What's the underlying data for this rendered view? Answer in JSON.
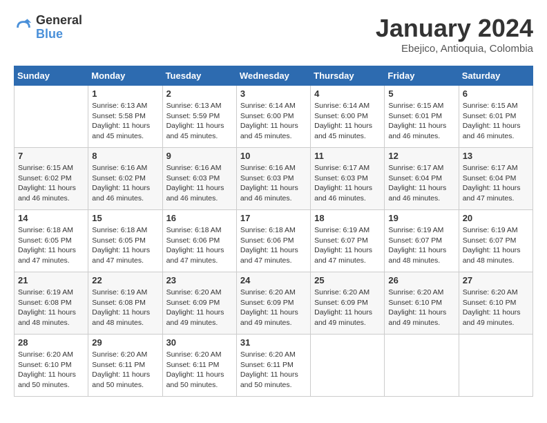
{
  "header": {
    "logo_line1": "General",
    "logo_line2": "Blue",
    "month_title": "January 2024",
    "location": "Ebejico, Antioquia, Colombia"
  },
  "weekdays": [
    "Sunday",
    "Monday",
    "Tuesday",
    "Wednesday",
    "Thursday",
    "Friday",
    "Saturday"
  ],
  "weeks": [
    [
      {
        "day": "",
        "empty": true
      },
      {
        "day": "1",
        "sunrise": "6:13 AM",
        "sunset": "5:58 PM",
        "daylight": "11 hours and 45 minutes."
      },
      {
        "day": "2",
        "sunrise": "6:13 AM",
        "sunset": "5:59 PM",
        "daylight": "11 hours and 45 minutes."
      },
      {
        "day": "3",
        "sunrise": "6:14 AM",
        "sunset": "6:00 PM",
        "daylight": "11 hours and 45 minutes."
      },
      {
        "day": "4",
        "sunrise": "6:14 AM",
        "sunset": "6:00 PM",
        "daylight": "11 hours and 45 minutes."
      },
      {
        "day": "5",
        "sunrise": "6:15 AM",
        "sunset": "6:01 PM",
        "daylight": "11 hours and 46 minutes."
      },
      {
        "day": "6",
        "sunrise": "6:15 AM",
        "sunset": "6:01 PM",
        "daylight": "11 hours and 46 minutes."
      }
    ],
    [
      {
        "day": "7",
        "sunrise": "6:15 AM",
        "sunset": "6:02 PM",
        "daylight": "11 hours and 46 minutes."
      },
      {
        "day": "8",
        "sunrise": "6:16 AM",
        "sunset": "6:02 PM",
        "daylight": "11 hours and 46 minutes."
      },
      {
        "day": "9",
        "sunrise": "6:16 AM",
        "sunset": "6:03 PM",
        "daylight": "11 hours and 46 minutes."
      },
      {
        "day": "10",
        "sunrise": "6:16 AM",
        "sunset": "6:03 PM",
        "daylight": "11 hours and 46 minutes."
      },
      {
        "day": "11",
        "sunrise": "6:17 AM",
        "sunset": "6:03 PM",
        "daylight": "11 hours and 46 minutes."
      },
      {
        "day": "12",
        "sunrise": "6:17 AM",
        "sunset": "6:04 PM",
        "daylight": "11 hours and 46 minutes."
      },
      {
        "day": "13",
        "sunrise": "6:17 AM",
        "sunset": "6:04 PM",
        "daylight": "11 hours and 47 minutes."
      }
    ],
    [
      {
        "day": "14",
        "sunrise": "6:18 AM",
        "sunset": "6:05 PM",
        "daylight": "11 hours and 47 minutes."
      },
      {
        "day": "15",
        "sunrise": "6:18 AM",
        "sunset": "6:05 PM",
        "daylight": "11 hours and 47 minutes."
      },
      {
        "day": "16",
        "sunrise": "6:18 AM",
        "sunset": "6:06 PM",
        "daylight": "11 hours and 47 minutes."
      },
      {
        "day": "17",
        "sunrise": "6:18 AM",
        "sunset": "6:06 PM",
        "daylight": "11 hours and 47 minutes."
      },
      {
        "day": "18",
        "sunrise": "6:19 AM",
        "sunset": "6:07 PM",
        "daylight": "11 hours and 47 minutes."
      },
      {
        "day": "19",
        "sunrise": "6:19 AM",
        "sunset": "6:07 PM",
        "daylight": "11 hours and 48 minutes."
      },
      {
        "day": "20",
        "sunrise": "6:19 AM",
        "sunset": "6:07 PM",
        "daylight": "11 hours and 48 minutes."
      }
    ],
    [
      {
        "day": "21",
        "sunrise": "6:19 AM",
        "sunset": "6:08 PM",
        "daylight": "11 hours and 48 minutes."
      },
      {
        "day": "22",
        "sunrise": "6:19 AM",
        "sunset": "6:08 PM",
        "daylight": "11 hours and 48 minutes."
      },
      {
        "day": "23",
        "sunrise": "6:20 AM",
        "sunset": "6:09 PM",
        "daylight": "11 hours and 49 minutes."
      },
      {
        "day": "24",
        "sunrise": "6:20 AM",
        "sunset": "6:09 PM",
        "daylight": "11 hours and 49 minutes."
      },
      {
        "day": "25",
        "sunrise": "6:20 AM",
        "sunset": "6:09 PM",
        "daylight": "11 hours and 49 minutes."
      },
      {
        "day": "26",
        "sunrise": "6:20 AM",
        "sunset": "6:10 PM",
        "daylight": "11 hours and 49 minutes."
      },
      {
        "day": "27",
        "sunrise": "6:20 AM",
        "sunset": "6:10 PM",
        "daylight": "11 hours and 49 minutes."
      }
    ],
    [
      {
        "day": "28",
        "sunrise": "6:20 AM",
        "sunset": "6:10 PM",
        "daylight": "11 hours and 50 minutes."
      },
      {
        "day": "29",
        "sunrise": "6:20 AM",
        "sunset": "6:11 PM",
        "daylight": "11 hours and 50 minutes."
      },
      {
        "day": "30",
        "sunrise": "6:20 AM",
        "sunset": "6:11 PM",
        "daylight": "11 hours and 50 minutes."
      },
      {
        "day": "31",
        "sunrise": "6:20 AM",
        "sunset": "6:11 PM",
        "daylight": "11 hours and 50 minutes."
      },
      {
        "day": "",
        "empty": true
      },
      {
        "day": "",
        "empty": true
      },
      {
        "day": "",
        "empty": true
      }
    ]
  ]
}
